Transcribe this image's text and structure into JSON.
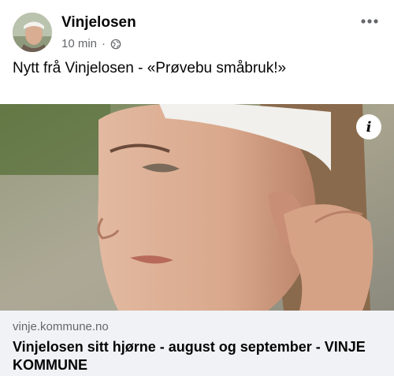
{
  "post": {
    "author": "Vinjelosen",
    "time": "10 min",
    "separator": "·",
    "audience_icon": "globe-icon",
    "more_icon": "more-options-icon",
    "text": "Nytt frå Vinjelosen - «Prøvebu småbruk!»"
  },
  "link_card": {
    "domain": "vinje.kommune.no",
    "title": "Vinjelosen sitt hjørne - august og september - VINJE KOMMUNE",
    "info_label": "i"
  },
  "colors": {
    "text_primary": "#050505",
    "text_secondary": "#65676b",
    "card_background": "#f0f2f5"
  }
}
